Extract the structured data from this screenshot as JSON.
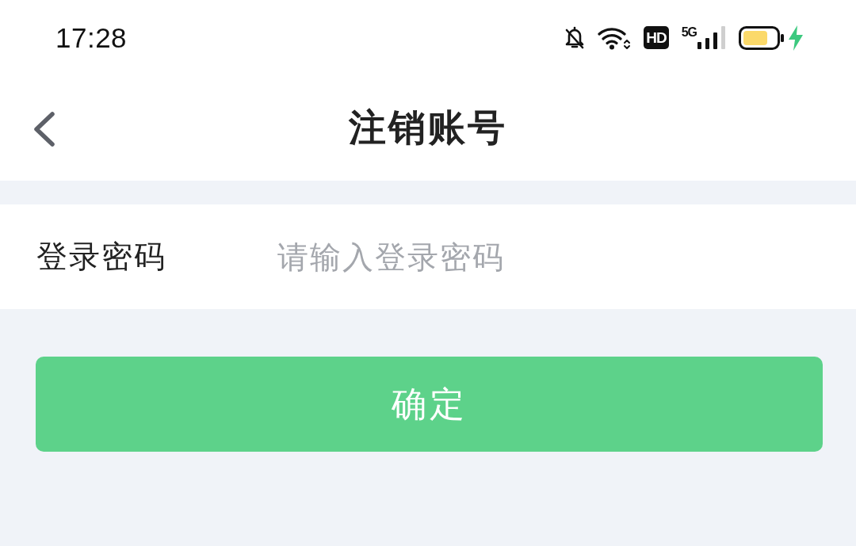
{
  "status_bar": {
    "time": "17:28",
    "hd_label": "HD",
    "network": "5G",
    "charging": true
  },
  "header": {
    "title": "注销账号"
  },
  "form": {
    "fields": [
      {
        "label": "登录密码",
        "placeholder": "请输入登录密码"
      }
    ]
  },
  "confirm_button": {
    "label": "确定"
  }
}
